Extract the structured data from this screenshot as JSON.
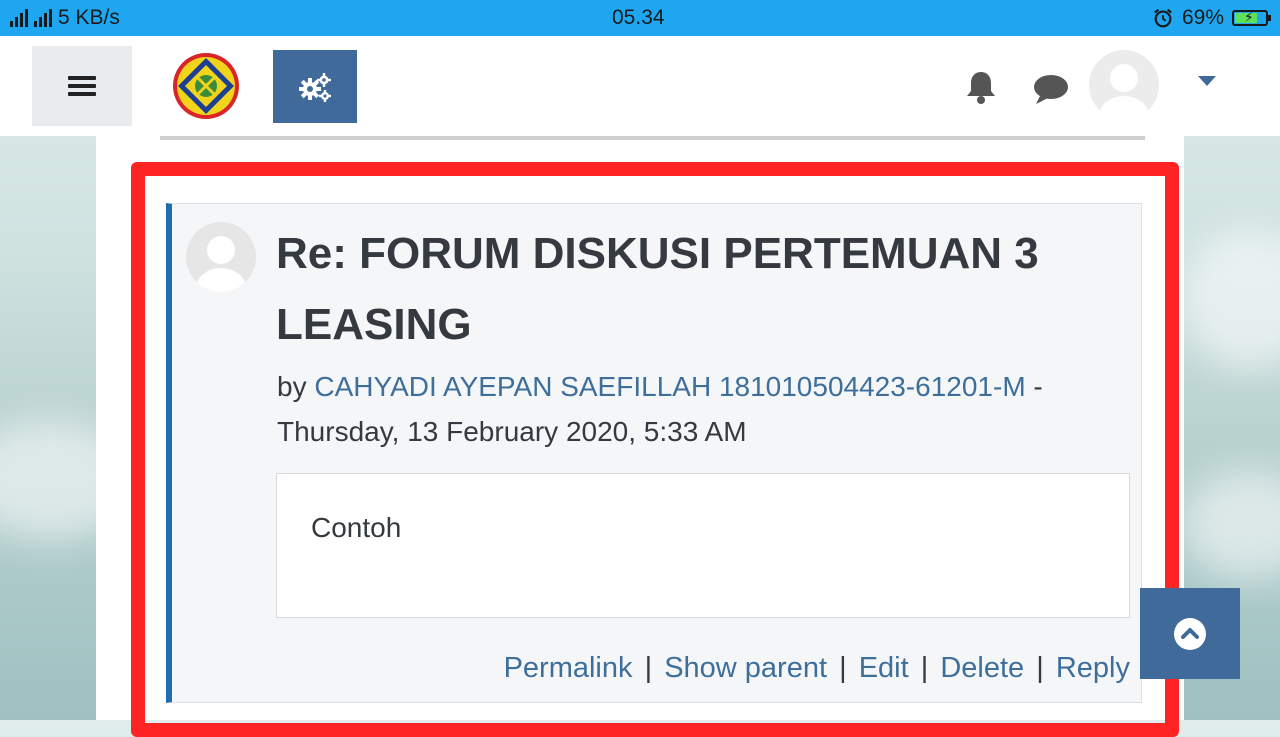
{
  "statusbar": {
    "network_speed": "5 KB/s",
    "time": "05.34",
    "battery_percent": "69%",
    "battery_level": 0.69,
    "signal_labels": [
      "4G",
      "R"
    ]
  },
  "navbar": {
    "icons": [
      "menu-icon",
      "school-logo",
      "gear-icon",
      "bell-icon",
      "chat-icon",
      "user-avatar",
      "caret-down-icon"
    ]
  },
  "post": {
    "title": "Re: FORUM DISKUSI PERTEMUAN 3 LEASING",
    "by_prefix": "by",
    "author": "CAHYADI AYEPAN SAEFILLAH 181010504423-61201-M",
    "date_separator": " -",
    "date": "Thursday, 13 February 2020, 5:33 AM",
    "content": "Contoh",
    "actions": {
      "permalink": "Permalink",
      "show_parent": "Show parent",
      "edit": "Edit",
      "delete": "Delete",
      "reply": "Reply",
      "separator": "|"
    }
  },
  "colors": {
    "statusbar": "#1ea7f0",
    "accent": "#3f6a99",
    "link": "#3e6f9b",
    "highlight": "#ff2424",
    "post_border": "#1f6fb0"
  }
}
